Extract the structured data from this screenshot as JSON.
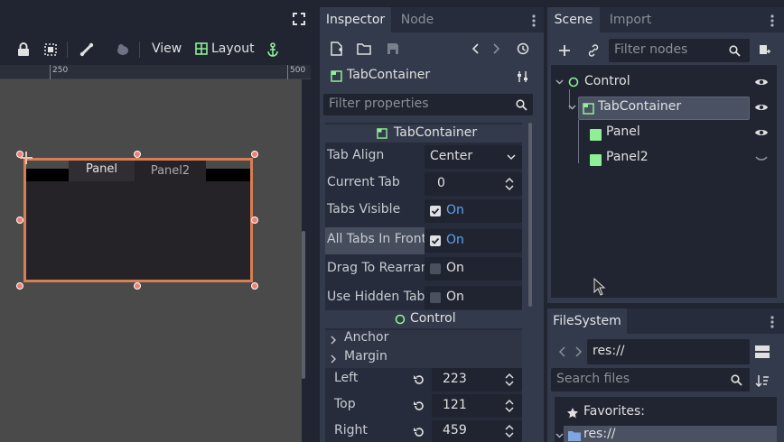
{
  "viewport": {
    "toolbar": {
      "view_label": "View",
      "layout_label": "Layout"
    },
    "ruler": {
      "tick_250": "250",
      "tick_500": "500"
    },
    "preview_tabs": [
      "Panel",
      "Panel2"
    ]
  },
  "inspector": {
    "tabs": [
      "Inspector",
      "Node"
    ],
    "object_name": "TabContainer",
    "filter_placeholder": "Filter properties",
    "class_header": "TabContainer",
    "props": {
      "tab_align": {
        "label": "Tab Align",
        "value": "Center"
      },
      "current_tab": {
        "label": "Current Tab",
        "value": "0"
      },
      "tabs_visible": {
        "label": "Tabs Visible",
        "value": "On"
      },
      "all_tabs_in_front": {
        "label": "All Tabs In Front",
        "value": "On"
      },
      "drag_to_rearrange": {
        "label": "Drag To Rearran",
        "value": "On"
      },
      "use_hidden_tabs": {
        "label": "Use Hidden Tabs",
        "value": "On"
      }
    },
    "control_header": "Control",
    "anchor_label": "Anchor",
    "margin_label": "Margin",
    "margins": {
      "left": {
        "label": "Left",
        "value": "223"
      },
      "top": {
        "label": "Top",
        "value": "121"
      },
      "right": {
        "label": "Right",
        "value": "459"
      }
    }
  },
  "scene": {
    "tabs": [
      "Scene",
      "Import"
    ],
    "filter_placeholder": "Filter nodes",
    "tree": {
      "control": "Control",
      "tabcontainer": "TabContainer",
      "panel": "Panel",
      "panel2": "Panel2"
    }
  },
  "filesystem": {
    "tab": "FileSystem",
    "path": "res://",
    "search_placeholder": "Search files",
    "favorites": "Favorites:",
    "res_item": "res://"
  },
  "colors": {
    "accent": "#699ce8",
    "selection_orange": "#d67f54",
    "control_green": "#8eef97",
    "checkbox_blue": "#5ea2ef"
  }
}
